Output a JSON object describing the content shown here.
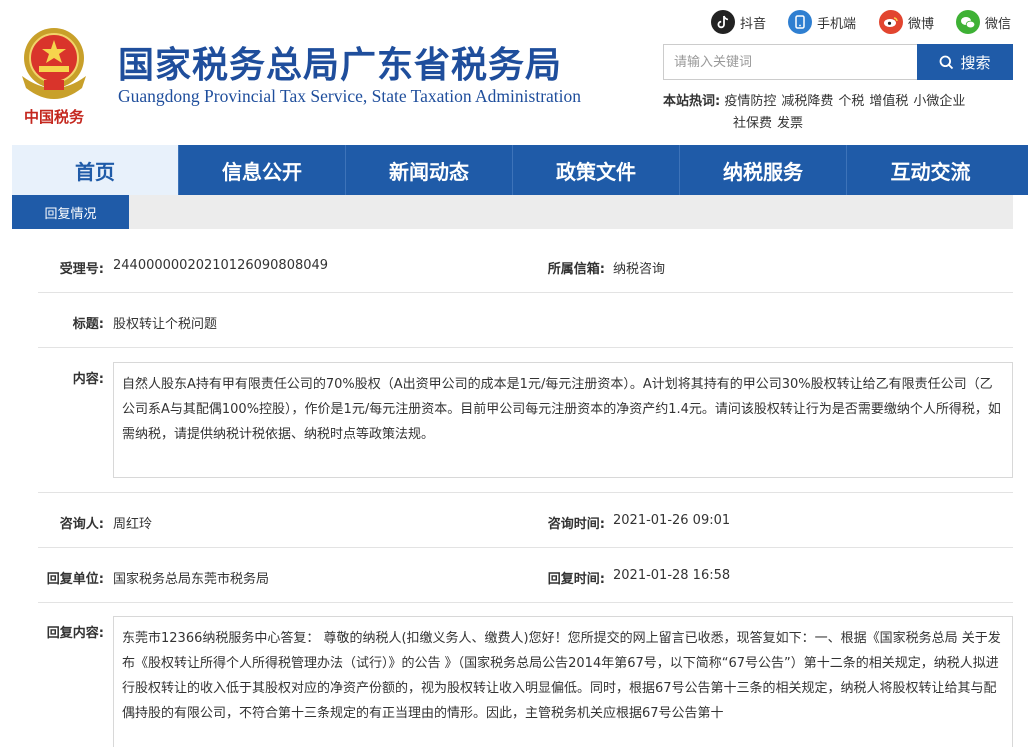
{
  "header": {
    "emblem_caption": "中国税务",
    "title_cn": "国家税务总局广东省税务局",
    "title_en": "Guangdong Provincial Tax Service, State Taxation Administration",
    "social": [
      {
        "label": "抖音",
        "icon": "douyin-icon",
        "color": "#222222"
      },
      {
        "label": "手机端",
        "icon": "mobile-icon",
        "color": "#2f7fd1"
      },
      {
        "label": "微博",
        "icon": "weibo-icon",
        "color": "#e2452f"
      },
      {
        "label": "微信",
        "icon": "wechat-icon",
        "color": "#3eb135"
      }
    ],
    "search": {
      "placeholder": "请输入关键词",
      "button_label": "搜索"
    },
    "hot_label": "本站热词:",
    "hot_words": [
      "疫情防控",
      "减税降费",
      "个税",
      "增值税",
      "小微企业",
      "社保费",
      "发票"
    ]
  },
  "nav": {
    "items": [
      "首页",
      "信息公开",
      "新闻动态",
      "政策文件",
      "纳税服务",
      "互动交流"
    ],
    "active_index": 0
  },
  "tab": {
    "label": "回复情况"
  },
  "detail": {
    "accept_no_label": "受理号:",
    "accept_no": "24400000020210126090808049",
    "mailbox_label": "所属信箱:",
    "mailbox": "纳税咨询",
    "title_label": "标题:",
    "title": "股权转让个税问题",
    "content_label": "内容:",
    "content": "自然人股东A持有甲有限责任公司的70%股权（A出资甲公司的成本是1元/每元注册资本）。A计划将其持有的甲公司30%股权转让给乙有限责任公司（乙公司系A与其配偶100%控股），作价是1元/每元注册资本。目前甲公司每元注册资本的净资产约1.4元。请问该股权转让行为是否需要缴纳个人所得税，如需纳税，请提供纳税计税依据、纳税时点等政策法规。",
    "asker_label": "咨询人:",
    "asker": "周红玲",
    "ask_time_label": "咨询时间:",
    "ask_time": "2021-01-26 09:01",
    "reply_unit_label": "回复单位:",
    "reply_unit": "国家税务总局东莞市税务局",
    "reply_time_label": "回复时间:",
    "reply_time": "2021-01-28 16:58",
    "reply_content_label": "回复内容:",
    "reply_content": "东莞市12366纳税服务中心答复： 尊敬的纳税人(扣缴义务人、缴费人)您好！您所提交的网上留言已收悉，现答复如下：一、根据《国家税务总局 关于发布《股权转让所得个人所得税管理办法（试行）》的公告 》（国家税务总局公告2014年第67号，以下简称“67号公告”）第十二条的相关规定，纳税人拟进行股权转让的收入低于其股权对应的净资产份额的，视为股权转让收入明显偏低。同时，根据67号公告第十三条的相关规定，纳税人将股权转让给其与配偶持股的有限公司，不符合第十三条规定的有正当理由的情形。因此，主管税务机关应根据67号公告第十"
  }
}
